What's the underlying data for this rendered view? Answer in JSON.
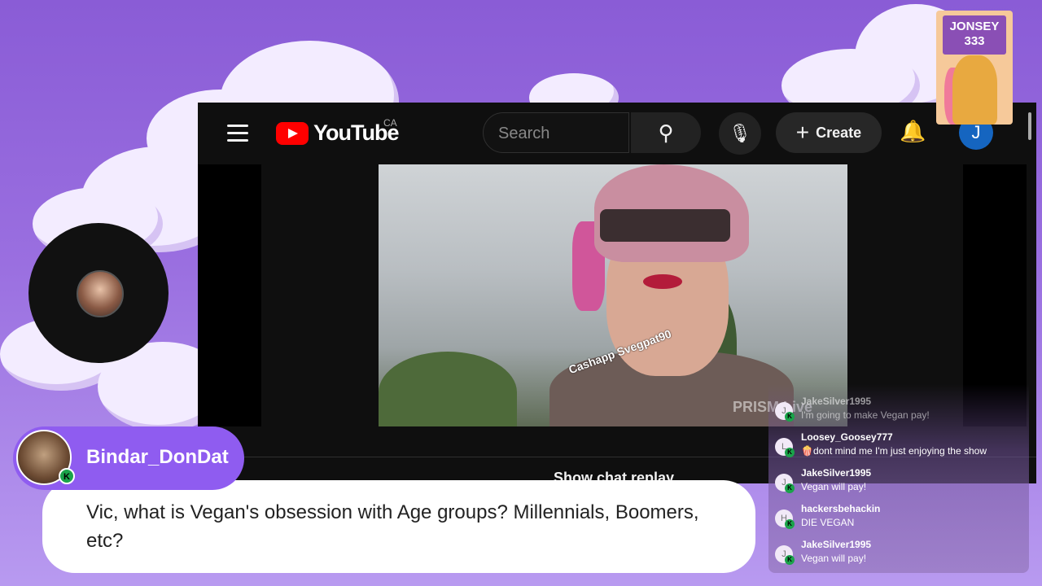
{
  "youtube": {
    "logo_text": "YouTube",
    "country": "CA",
    "search_placeholder": "Search",
    "create_label": "Create",
    "user_initial": "J",
    "show_chat_replay": "Show chat replay",
    "video_watermark": "Cashapp Svegpat90",
    "video_overlay": "PRISM Live"
  },
  "sticker": {
    "line1": "JONSEY",
    "line2": "333"
  },
  "chat": {
    "messages": [
      {
        "initial": "J",
        "name": "JakeSilver1995",
        "text": "I'm going to make Vegan pay!"
      },
      {
        "initial": "L",
        "name": "Loosey_Goosey777",
        "text": "🍿dont mind me I'm just enjoying the show"
      },
      {
        "initial": "J",
        "name": "JakeSilver1995",
        "text": "Vegan will pay!"
      },
      {
        "initial": "H",
        "name": "hackersbehackin",
        "text": "DIE VEGAN"
      },
      {
        "initial": "J",
        "name": "JakeSilver1995",
        "text": "Vegan will pay!"
      }
    ]
  },
  "featured": {
    "username": "Bindar_DonDat",
    "message": "Vic, what is Vegan's obsession with Age groups? Millennials, Boomers, etc?"
  },
  "colors": {
    "background": "#8a5cd6",
    "pill": "#8f5cf0",
    "youtube_red": "#ff0000",
    "badge_green": "#1aa34a"
  },
  "icons": [
    "menu-icon",
    "search-icon",
    "mic-icon",
    "plus-icon",
    "bell-icon"
  ]
}
